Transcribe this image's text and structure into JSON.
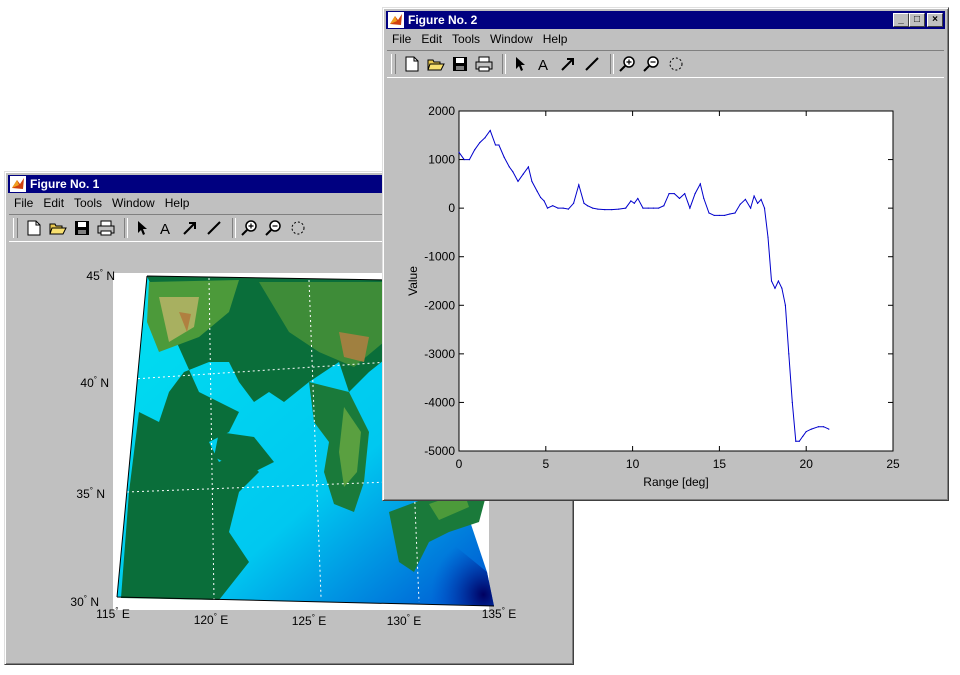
{
  "menu": {
    "file": "File",
    "edit": "Edit",
    "tools": "Tools",
    "window": "Window",
    "help": "Help"
  },
  "fig1": {
    "title": "Figure No. 1",
    "map": {
      "lat_labels": [
        "45",
        "40",
        "35",
        "30"
      ],
      "lat_suffix": "N",
      "lon_labels": [
        "115",
        "120",
        "125",
        "130",
        "135"
      ],
      "lon_suffix": "E",
      "deg": "°"
    }
  },
  "fig2": {
    "title": "Figure No. 2",
    "window_buttons": {
      "minimize": "_",
      "maximize": "□",
      "close": "×"
    }
  },
  "icons": [
    "new-file-icon",
    "open-folder-icon",
    "save-icon",
    "print-icon",
    "select-arrow-icon",
    "text-icon",
    "arrow-icon",
    "line-icon",
    "zoom-in-icon",
    "zoom-out-icon",
    "rotate-icon"
  ],
  "chart_data": {
    "type": "line",
    "title": "",
    "xlabel": "Range [deg]",
    "ylabel": "Value",
    "xlim": [
      0,
      25
    ],
    "ylim": [
      -5000,
      2000
    ],
    "xticks": [
      0,
      5,
      10,
      15,
      20,
      25
    ],
    "yticks": [
      -5000,
      -4000,
      -3000,
      -2000,
      -1000,
      0,
      1000,
      2000
    ],
    "grid": false,
    "line_color": "#0000cc",
    "series": [
      {
        "x": [
          0,
          0.3,
          0.6,
          0.9,
          1.2,
          1.5,
          1.8,
          2.1,
          2.3,
          2.6,
          2.9,
          3.1,
          3.4,
          3.7,
          4.0,
          4.2,
          4.5,
          4.7,
          4.9,
          5.1,
          5.4,
          5.7,
          6.0,
          6.3,
          6.6,
          6.9,
          7.2,
          7.4,
          7.7,
          8.0,
          8.4,
          8.8,
          9.2,
          9.6,
          9.9,
          10.1,
          10.3,
          10.6,
          10.9,
          11.2,
          11.5,
          11.8,
          12.1,
          12.4,
          12.7,
          13.0,
          13.3,
          13.6,
          13.9,
          14.1,
          14.4,
          14.7,
          15.0,
          15.3,
          15.6,
          15.9,
          16.2,
          16.5,
          16.8,
          17.0,
          17.2,
          17.4,
          17.6,
          17.8,
          18.0,
          18.2,
          18.4,
          18.6,
          18.8,
          19.0,
          19.2,
          19.4,
          19.6,
          19.8,
          20.0,
          20.3,
          20.7,
          21.0,
          21.3
        ],
        "y": [
          1150,
          1000,
          1000,
          1200,
          1350,
          1450,
          1600,
          1300,
          1300,
          1050,
          850,
          750,
          550,
          700,
          850,
          550,
          350,
          220,
          150,
          0,
          50,
          0,
          0,
          -20,
          100,
          480,
          100,
          50,
          0,
          -20,
          -30,
          -30,
          -20,
          0,
          150,
          100,
          200,
          0,
          0,
          0,
          0,
          50,
          300,
          300,
          200,
          300,
          0,
          300,
          500,
          200,
          -100,
          -150,
          -150,
          -150,
          -120,
          -100,
          80,
          180,
          0,
          250,
          100,
          180,
          0,
          -600,
          -1500,
          -1650,
          -1500,
          -1650,
          -2000,
          -3000,
          -4000,
          -4800,
          -4800,
          -4700,
          -4600,
          -4550,
          -4500,
          -4500,
          -4550
        ]
      }
    ]
  }
}
